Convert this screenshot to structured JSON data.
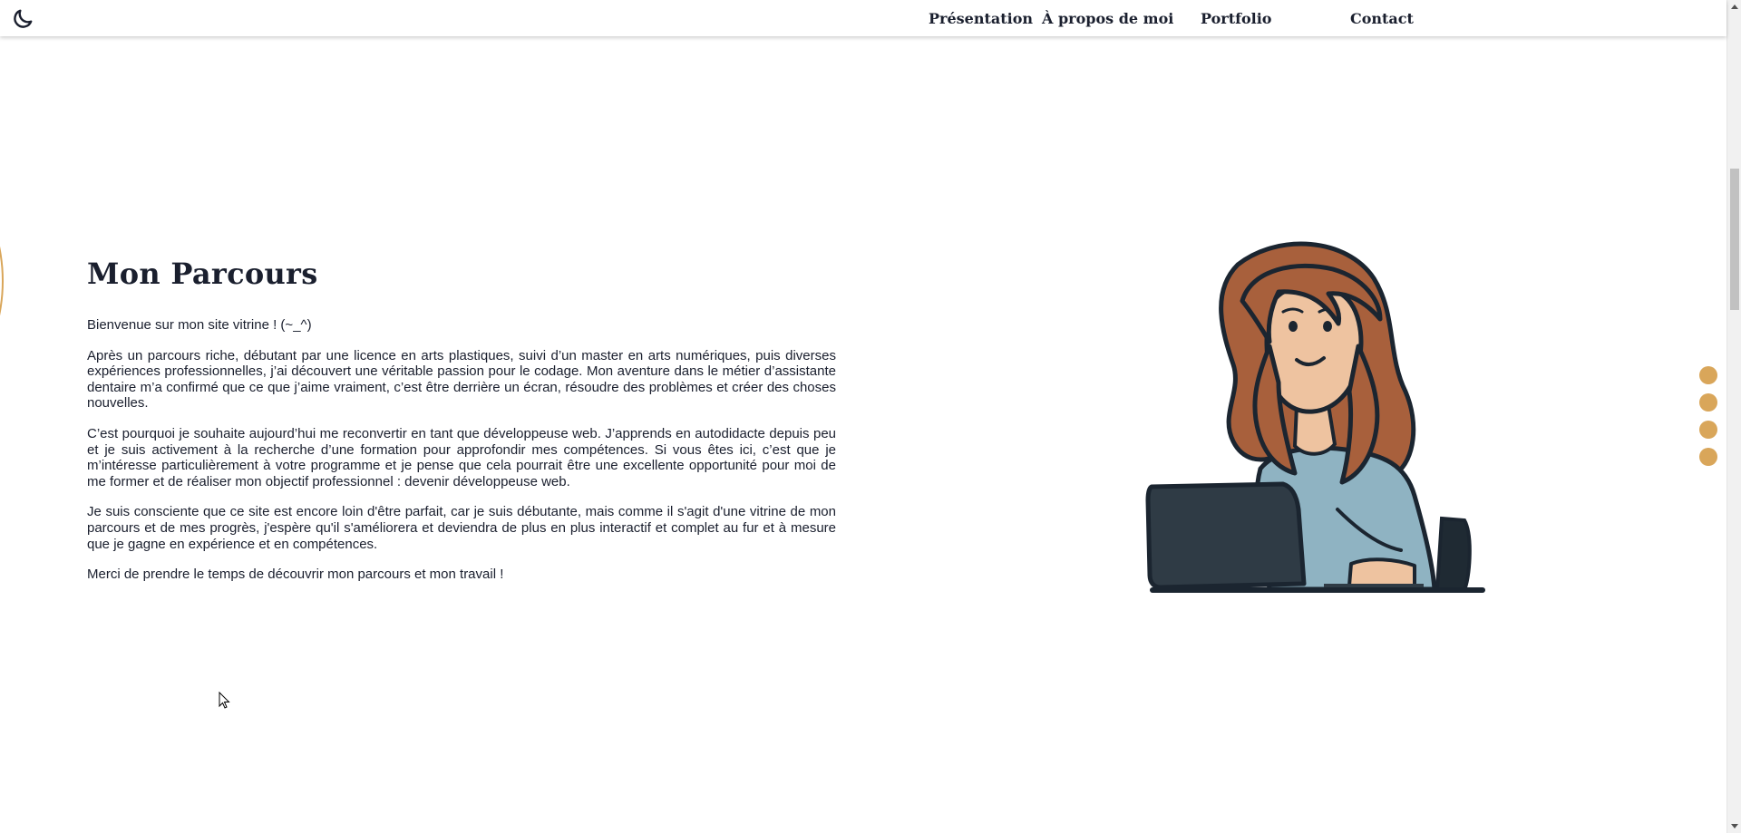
{
  "nav": {
    "theme_toggle_icon": "moon-icon",
    "links": [
      "Présentation",
      "À propos de moi",
      "Portfolio",
      "Contact"
    ]
  },
  "about": {
    "title": "Mon Parcours",
    "paragraphs": [
      "Bienvenue sur mon site vitrine ! (~_^)",
      "Après un parcours riche, débutant par une licence en arts plastiques, suivi d’un master en arts numériques, puis diverses expériences professionnelles, j’ai découvert une véritable passion pour le codage. Mon aventure dans le métier d’assistante dentaire m’a confirmé que ce que j’aime vraiment, c’est être derrière un écran, résoudre des problèmes et créer des choses nouvelles.",
      "C’est pourquoi je souhaite aujourd’hui me reconvertir en tant que développeuse web. J’apprends en autodidacte depuis peu et je suis activement à la recherche d’une formation pour approfondir mes compétences. Si vous êtes ici, c’est que je m’intéresse particulièrement à votre programme et je pense que cela pourrait être une excellente opportunité pour moi de me former et de réaliser mon objectif professionnel : devenir développeuse web.",
      "Je suis consciente que ce site est encore loin d'être parfait, car je suis débutante, mais comme il s'agit d'une vitrine de mon parcours et de mes progrès, j'espère qu'il s'améliorera et deviendra de plus en plus interactif et complet au fur et à mesure que je gagne en expérience et en compétences.",
      "Merci de prendre le temps de découvrir mon parcours et mon travail !"
    ],
    "illustration_icon": "woman-at-laptop-illustration"
  },
  "side_nav": {
    "dot_count": 4,
    "dot_color": "#d9a65a"
  },
  "colors": {
    "text": "#1a1f2e",
    "accent": "#d9a65a",
    "background": "#ffffff"
  }
}
